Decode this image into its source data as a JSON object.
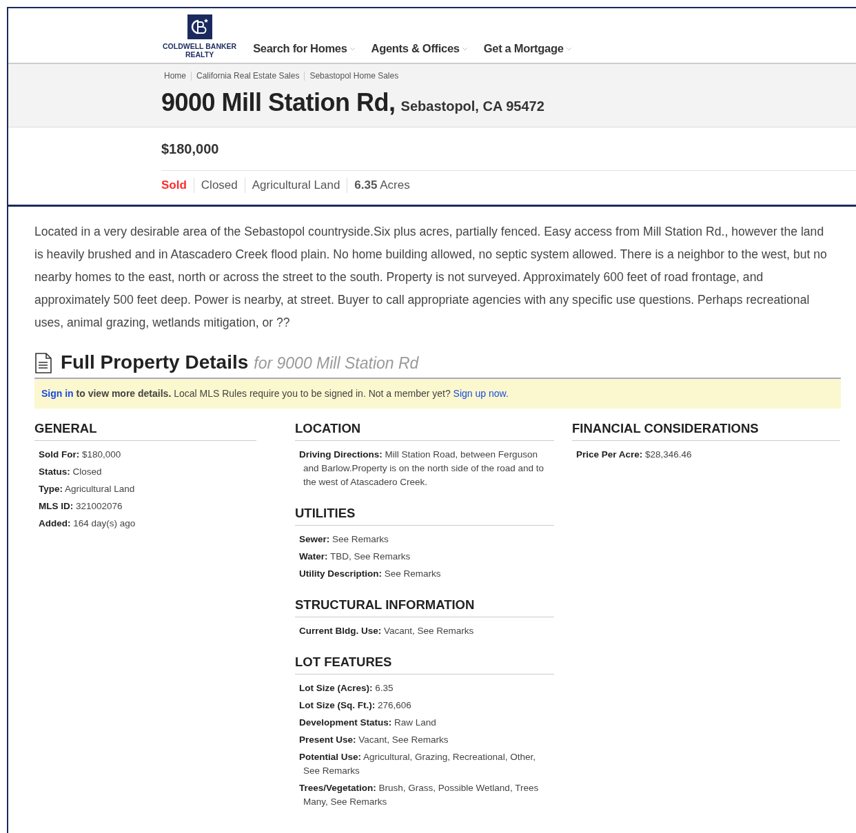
{
  "header": {
    "brand": [
      "COLDWELL BANKER",
      "REALTY"
    ],
    "nav": [
      {
        "label": "Search for Homes"
      },
      {
        "label": "Agents & Offices"
      },
      {
        "label": "Get a Mortgage"
      }
    ],
    "breadcrumbs": [
      "Home",
      "California Real Estate Sales",
      "Sebastopol Home Sales"
    ],
    "title": "9000 Mill Station Rd,",
    "subtitle": "Sebastopol, CA 95472",
    "price": "$180,000",
    "tags": [
      {
        "text": "Sold",
        "color": "#ff2b2b"
      },
      {
        "text": "Closed",
        "color": "#555555"
      },
      {
        "text": "Agricultural Land",
        "color": "#555555"
      },
      {
        "text": "**6.35** Acres",
        "color": "#555555"
      }
    ]
  },
  "description": "Located in a very desirable area of the Sebastopol countryside.Six plus acres, partially fenced. Easy access from Mill Station Rd., however the land is heavily brushed and in Atascadero Creek flood plain. No home building allowed, no septic system allowed. There is a neighbor to the west, but no nearby homes to the east, north or across the street to the south. Property is not surveyed. Approximately 600 feet of road frontage, and approximately 500 feet deep. Power is nearby, at street. Buyer to call appropriate agencies with any specific use questions. Perhaps recreational uses, animal grazing, wetlands mitigation, or ??",
  "details": {
    "title": "Full Property Details",
    "subtitle": "for 9000 Mill Station Rd",
    "notice": {
      "sign_in": "Sign in",
      "bold": "to view more details.",
      "text": "Local MLS Rules require you to be signed in. Not a member yet?",
      "sign_up": "Sign up now."
    },
    "columns": [
      [
        {
          "heading": "GENERAL",
          "fields": [
            {
              "label": "Sold For:",
              "value": "$180,000"
            },
            {
              "label": "Status:",
              "value": "Closed"
            },
            {
              "label": "Type:",
              "value": "Agricultural Land"
            },
            {
              "label": "MLS ID:",
              "value": "321002076"
            },
            {
              "label": "Added:",
              "value": "164 day(s) ago"
            }
          ]
        }
      ],
      [
        {
          "heading": "LOCATION",
          "fields": [
            {
              "label": "Driving Directions:",
              "value": "Mill Station Road, between Ferguson and Barlow.Property is on the north side of the road and to the west of Atascadero Creek."
            }
          ]
        },
        {
          "heading": "UTILITIES",
          "fields": [
            {
              "label": "Sewer:",
              "value": "See Remarks"
            },
            {
              "label": "Water:",
              "value": "TBD, See Remarks"
            },
            {
              "label": "Utility Description:",
              "value": "See Remarks"
            }
          ]
        },
        {
          "heading": "STRUCTURAL INFORMATION",
          "fields": [
            {
              "label": "Current Bldg. Use:",
              "value": "Vacant, See Remarks"
            }
          ]
        },
        {
          "heading": "LOT FEATURES",
          "fields": [
            {
              "label": "Lot Size (Acres):",
              "value": "6.35"
            },
            {
              "label": "Lot Size (Sq. Ft.):",
              "value": "276,606"
            },
            {
              "label": "Development Status:",
              "value": "Raw Land"
            },
            {
              "label": "Present Use:",
              "value": "Vacant, See Remarks"
            },
            {
              "label": "Potential Use:",
              "value": "Agricultural, Grazing, Recreational, Other, See Remarks"
            },
            {
              "label": "Trees/Vegetation:",
              "value": "Brush, Grass, Possible Wetland, Trees Many, See Remarks"
            }
          ]
        }
      ],
      [
        {
          "heading": "FINANCIAL CONSIDERATIONS",
          "fields": [
            {
              "label": "Price Per Acre:",
              "value": "$28,346.46"
            }
          ]
        }
      ]
    ]
  }
}
